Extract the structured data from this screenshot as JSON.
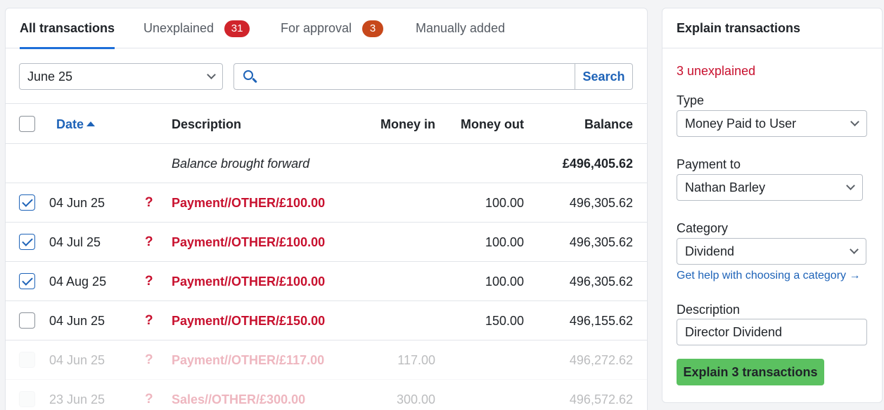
{
  "tabs": [
    {
      "label": "All transactions",
      "active": true
    },
    {
      "label": "Unexplained",
      "badge": "31"
    },
    {
      "label": "For approval",
      "badge": "3"
    },
    {
      "label": "Manually added"
    }
  ],
  "filter": {
    "date_value": "June 25",
    "search_placeholder": "",
    "search_button": "Search"
  },
  "table": {
    "headers": {
      "date": "Date",
      "description": "Description",
      "money_in": "Money in",
      "money_out": "Money out",
      "balance": "Balance"
    },
    "brought_forward": {
      "label": "Balance brought forward",
      "balance": "£496,405.62"
    },
    "rows": [
      {
        "checked": true,
        "disabled": false,
        "date": "04 Jun 25",
        "mark": "?",
        "description": "Payment//OTHER/£100.00",
        "money_in": "",
        "money_out": "100.00",
        "balance": "496,305.62"
      },
      {
        "checked": true,
        "disabled": false,
        "date": "04 Jul 25",
        "mark": "?",
        "description": "Payment//OTHER/£100.00",
        "money_in": "",
        "money_out": "100.00",
        "balance": "496,305.62"
      },
      {
        "checked": true,
        "disabled": false,
        "date": "04 Aug 25",
        "mark": "?",
        "description": "Payment//OTHER/£100.00",
        "money_in": "",
        "money_out": "100.00",
        "balance": "496,305.62"
      },
      {
        "checked": false,
        "disabled": false,
        "date": "04 Jun 25",
        "mark": "?",
        "description": "Payment//OTHER/£150.00",
        "money_in": "",
        "money_out": "150.00",
        "balance": "496,155.62"
      },
      {
        "checked": false,
        "disabled": true,
        "date": "04 Jun 25",
        "mark": "?",
        "description": "Payment//OTHER/£117.00",
        "money_in": "117.00",
        "money_out": "",
        "balance": "496,272.62"
      },
      {
        "checked": false,
        "disabled": true,
        "date": "23 Jun 25",
        "mark": "?",
        "description": "Sales//OTHER/£300.00",
        "money_in": "300.00",
        "money_out": "",
        "balance": "496,572.62"
      }
    ]
  },
  "side": {
    "title": "Explain transactions",
    "unexplained": "3 unexplained",
    "type_label": "Type",
    "type_value": "Money Paid to User",
    "payment_to_label": "Payment to",
    "payment_to_value": "Nathan Barley",
    "category_label": "Category",
    "category_value": "Dividend",
    "help_link": "Get help with choosing a category →",
    "description_label": "Description",
    "description_value": "Director Dividend",
    "explain_button": "Explain 3 transactions"
  },
  "colors": {
    "accent": "#1e63b8",
    "danger": "#c8102e",
    "success": "#5bc160",
    "badge_orange": "#c7481b"
  }
}
